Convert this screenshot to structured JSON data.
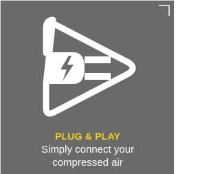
{
  "feature": {
    "title": "PLUG & PLAY",
    "description_line1": "Simply connect your",
    "description_line2": "compressed air",
    "icon": "plug-lightning-play-icon"
  },
  "colors": {
    "background": "#6a6a6a",
    "accent": "#f4d21a",
    "text": "#ffffff",
    "icon": "#ffffff"
  }
}
